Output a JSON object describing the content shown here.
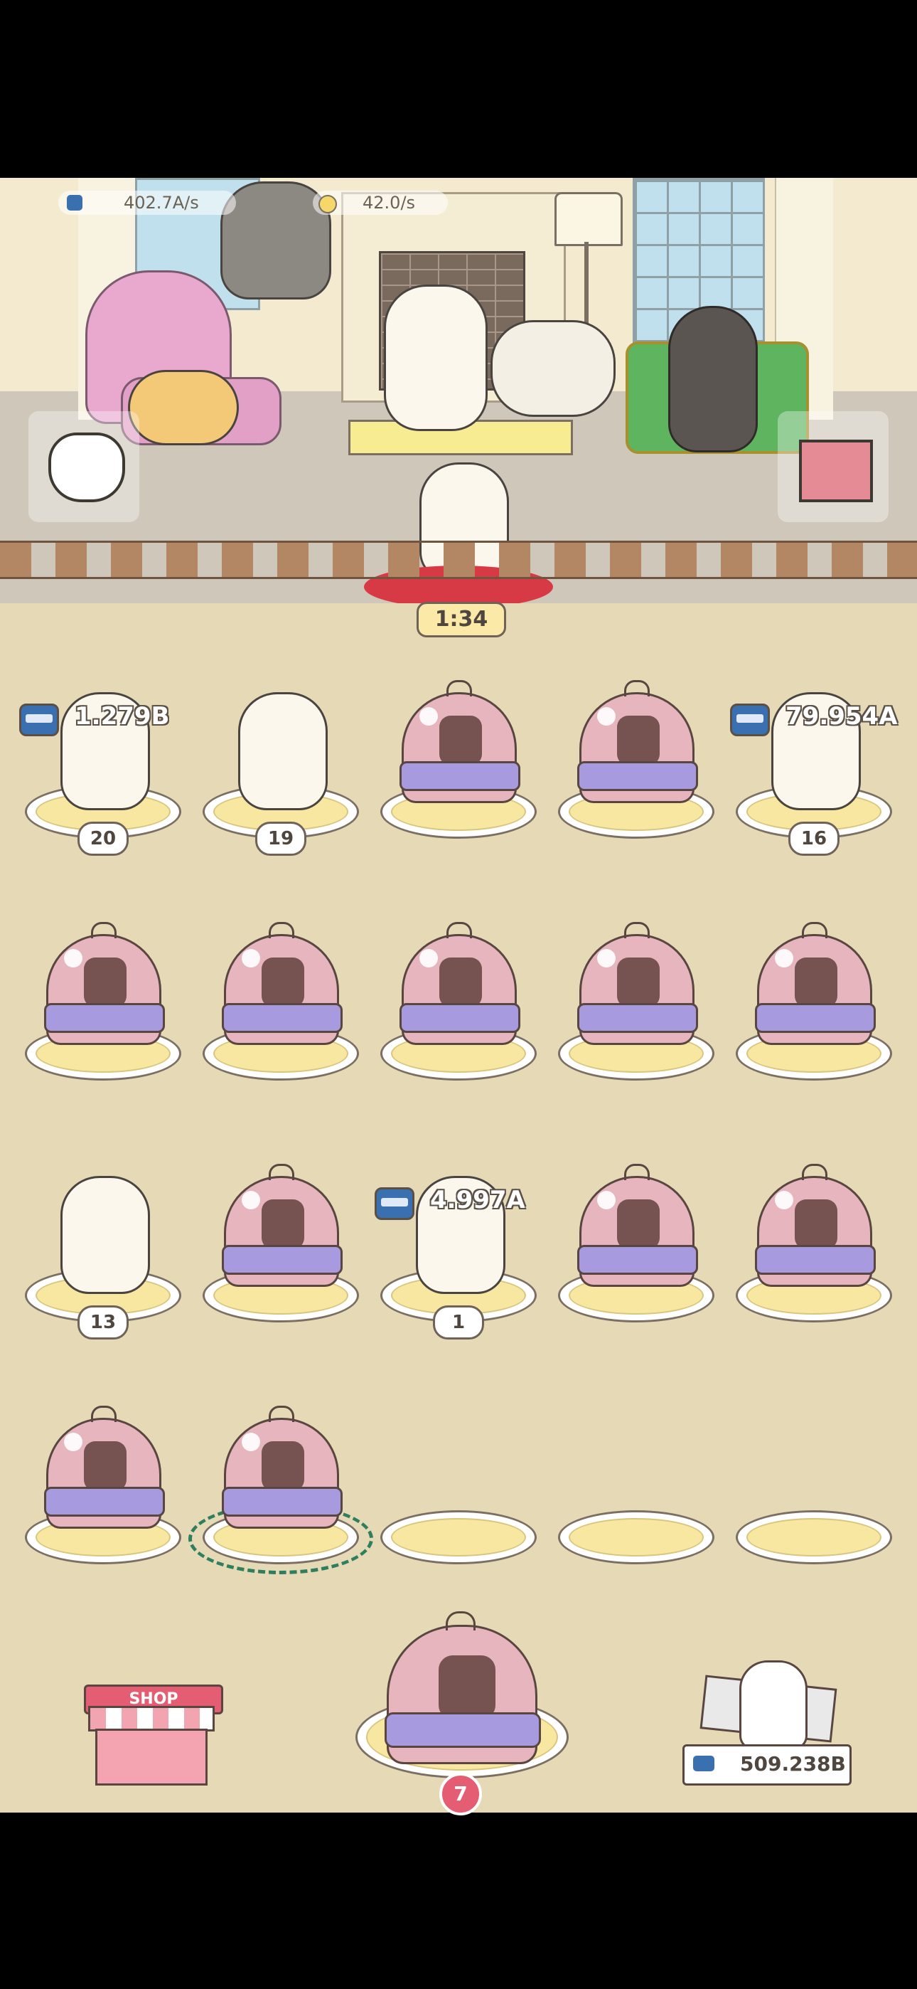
{
  "hud": {
    "fish_rate": "402.7A/s",
    "coin_rate": "42.0/s",
    "timer": "1:34"
  },
  "grid": {
    "slots": [
      {
        "kind": "cat",
        "level": "20",
        "earning": "1.279B"
      },
      {
        "kind": "cat",
        "level": "19",
        "earning": ""
      },
      {
        "kind": "box",
        "level": "",
        "earning": ""
      },
      {
        "kind": "box",
        "level": "",
        "earning": ""
      },
      {
        "kind": "cat",
        "level": "16",
        "earning": "79.954A"
      },
      {
        "kind": "box",
        "level": "",
        "earning": ""
      },
      {
        "kind": "box",
        "level": "",
        "earning": ""
      },
      {
        "kind": "box",
        "level": "",
        "earning": ""
      },
      {
        "kind": "box",
        "level": "",
        "earning": ""
      },
      {
        "kind": "box",
        "level": "",
        "earning": ""
      },
      {
        "kind": "cat",
        "level": "13",
        "earning": ""
      },
      {
        "kind": "box",
        "level": "",
        "earning": ""
      },
      {
        "kind": "cat",
        "level": "1",
        "earning": "4.997A"
      },
      {
        "kind": "box",
        "level": "",
        "earning": ""
      },
      {
        "kind": "box",
        "level": "",
        "earning": ""
      },
      {
        "kind": "box",
        "level": "",
        "earning": ""
      },
      {
        "kind": "box",
        "level": "",
        "earning": "",
        "selected": true
      },
      {
        "kind": "empty",
        "level": "",
        "earning": ""
      },
      {
        "kind": "empty",
        "level": "",
        "earning": ""
      },
      {
        "kind": "empty",
        "level": "",
        "earning": ""
      }
    ]
  },
  "bottom": {
    "shop_label": "SHOP",
    "box_count": "7",
    "balance": "509.238B"
  },
  "colors": {
    "board_bg": "#e6dab6",
    "dome": "#e6b5be",
    "accent_green": "#2f7f5f"
  }
}
